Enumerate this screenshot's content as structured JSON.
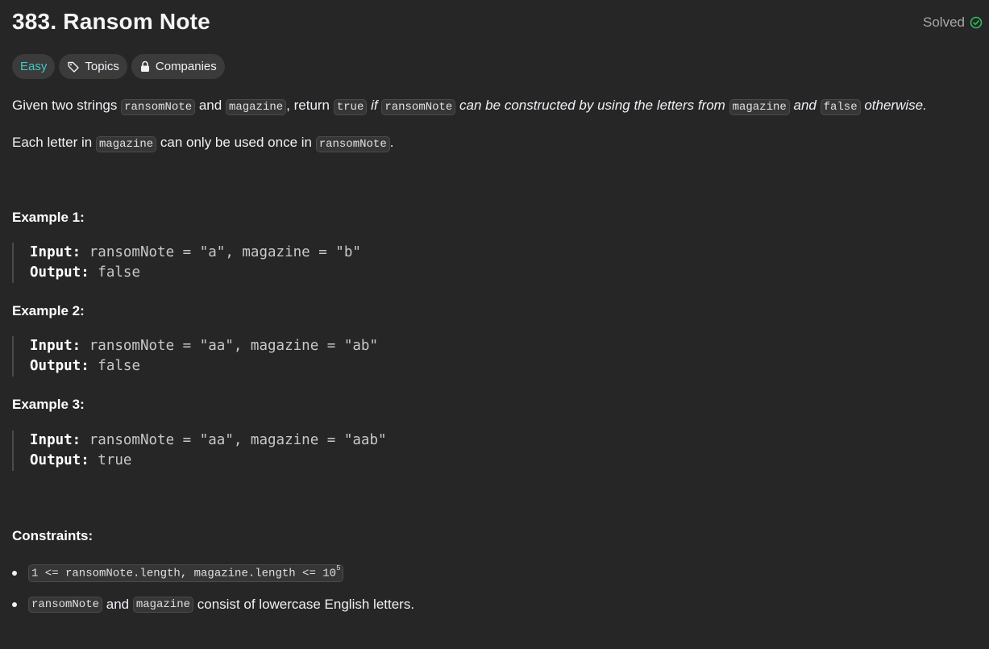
{
  "problem": {
    "title": "383. Ransom Note",
    "status": "Solved"
  },
  "tags": {
    "difficulty": "Easy",
    "topics": "Topics",
    "companies": "Companies"
  },
  "description": {
    "p1": {
      "t1": "Given two strings ",
      "c1": "ransomNote",
      "t2": " and ",
      "c2": "magazine",
      "t3": ", return ",
      "c3": "true",
      "t4": " if ",
      "c4": "ransomNote",
      "t5": " can be constructed by using the letters from ",
      "c5": "magazine",
      "t6": " and ",
      "c6": "false",
      "t7": " otherwise."
    },
    "p2": {
      "t1": "Each letter in ",
      "c1": "magazine",
      "t2": " can only be used once in ",
      "c2": "ransomNote",
      "t3": "."
    }
  },
  "examples": [
    {
      "heading": "Example 1:",
      "input_label": "Input:",
      "input": " ransomNote = \"a\", magazine = \"b\"",
      "output_label": "Output:",
      "output": " false"
    },
    {
      "heading": "Example 2:",
      "input_label": "Input:",
      "input": " ransomNote = \"aa\", magazine = \"ab\"",
      "output_label": "Output:",
      "output": " false"
    },
    {
      "heading": "Example 3:",
      "input_label": "Input:",
      "input": " ransomNote = \"aa\", magazine = \"aab\"",
      "output_label": "Output:",
      "output": " true"
    }
  ],
  "constraints": {
    "heading": "Constraints:",
    "c1": {
      "code": "1 <= ransomNote.length, magazine.length <= 10",
      "exp": "5"
    },
    "c2": {
      "code1": "ransomNote",
      "t1": " and ",
      "code2": "magazine",
      "t2": " consist of lowercase English letters."
    }
  }
}
